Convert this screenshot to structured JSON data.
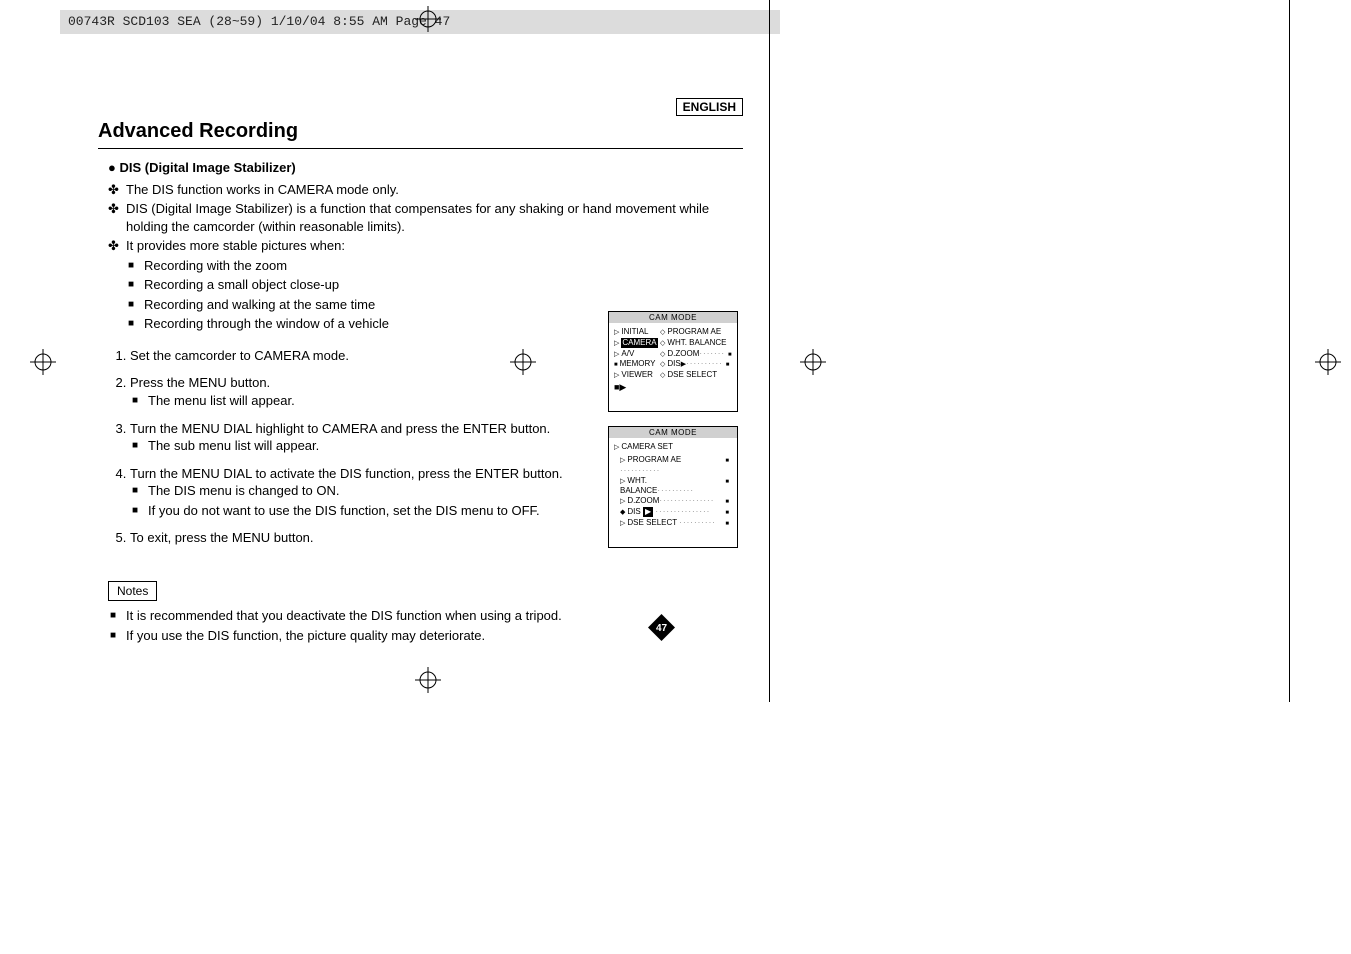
{
  "header": "00743R SCD103 SEA (28~59)  1/10/04 8:55 AM  Page 47",
  "lang": "ENGLISH",
  "title": "Advanced Recording",
  "section": {
    "heading": "DIS (Digital Image Stabilizer)",
    "points": [
      "The DIS function works in CAMERA mode only.",
      "DIS (Digital Image Stabilizer) is a function that compensates for any shaking or hand movement while holding the camcorder (within reasonable limits).",
      "It provides more stable pictures when:"
    ],
    "subpoints": [
      "Recording with the zoom",
      "Recording a small object close-up",
      "Recording and walking at the same time",
      "Recording through the window of a vehicle"
    ]
  },
  "steps": [
    {
      "text": "Set the camcorder to CAMERA mode.",
      "subs": []
    },
    {
      "text": "Press the MENU button.",
      "subs": [
        "The menu list will appear."
      ]
    },
    {
      "text": "Turn the MENU DIAL highlight to CAMERA and press the ENTER button.",
      "subs": [
        "The sub menu list will appear."
      ]
    },
    {
      "text": "Turn the MENU DIAL to activate the DIS function, press the ENTER button.",
      "subs": [
        "The DIS menu is changed to ON.",
        "If you do not want to use the DIS function, set the DIS menu to OFF."
      ]
    },
    {
      "text": "To exit, press the MENU button.",
      "subs": []
    }
  ],
  "notes_label": "Notes",
  "notes": [
    "It is recommended that you deactivate the DIS function when using a tripod.",
    "If you use the DIS function, the picture quality may deteriorate."
  ],
  "osd1": {
    "title": "CAM MODE",
    "left": [
      "INITIAL",
      "CAMERA",
      "A/V",
      "MEMORY",
      "VIEWER"
    ],
    "right": [
      "PROGRAM AE",
      "WHT. BALANCE",
      "D.ZOOM",
      "DIS",
      "DSE SELECT"
    ]
  },
  "osd2": {
    "title": "CAM MODE",
    "subtitle": "CAMERA SET",
    "rows": [
      "PROGRAM AE",
      "WHT. BALANCE",
      "D.ZOOM",
      "DIS",
      "DSE SELECT"
    ]
  },
  "page_no": "47"
}
